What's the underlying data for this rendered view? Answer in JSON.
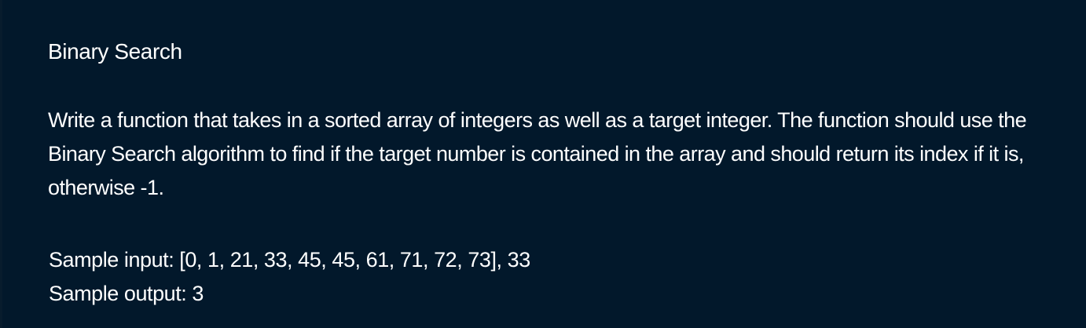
{
  "problem": {
    "title": "Binary Search",
    "description": "Write a function that takes in a sorted array of integers as well as a target integer. The function should use the Binary Search algorithm to find if the target number is contained in the array and should return its index if it is, otherwise -1.",
    "samples": {
      "input_line": "Sample input: [0, 1, 21, 33, 45, 45, 61, 71, 72, 73], 33",
      "output_line": "Sample output: 3"
    }
  },
  "colors": {
    "background": "#02182b",
    "text": "#ffffff"
  }
}
